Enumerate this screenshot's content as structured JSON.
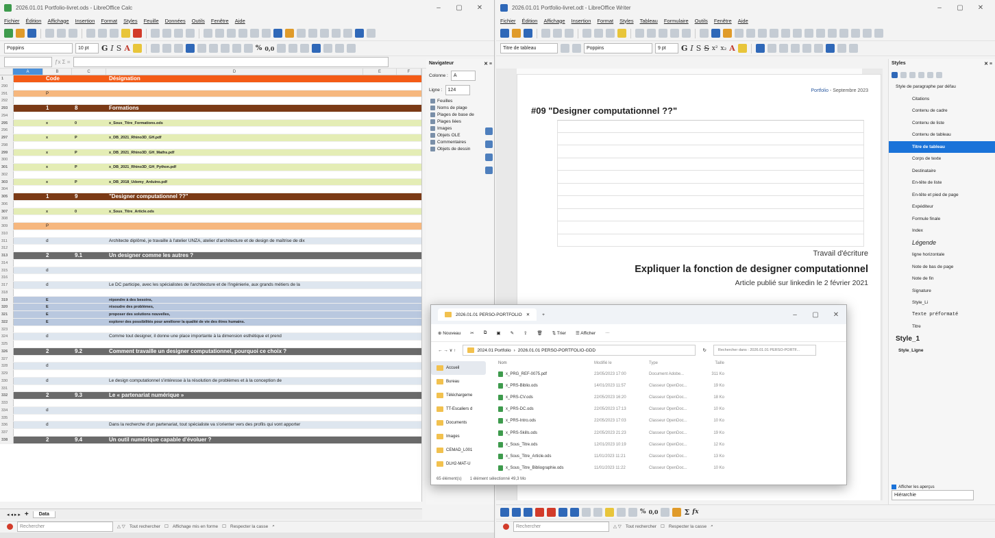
{
  "calc": {
    "title": "2026.01.01 Portfolio-livret.ods - LibreOffice Calc",
    "menu": [
      "Fichier",
      "Édition",
      "Affichage",
      "Insertion",
      "Format",
      "Styles",
      "Feuille",
      "Données",
      "Outils",
      "Fenêtre",
      "Aide"
    ],
    "font_name": "Poppins",
    "font_size": "10 pt",
    "columns": [
      "A",
      "B",
      "C",
      "D",
      "E",
      "F"
    ],
    "rows": [
      {
        "n": "1",
        "style": "hdr",
        "b": "Code",
        "c": "",
        "d": "Désignation"
      },
      {
        "n": "290",
        "style": "",
        "b": "",
        "c": "",
        "d": ""
      },
      {
        "n": "291",
        "style": "orange",
        "b": "P",
        "c": "",
        "d": ""
      },
      {
        "n": "292",
        "style": "",
        "b": "",
        "c": "",
        "d": ""
      },
      {
        "n": "293",
        "style": "sec",
        "b": "1",
        "c": "8",
        "d": "Formations"
      },
      {
        "n": "294",
        "style": "",
        "b": "",
        "c": "",
        "d": ""
      },
      {
        "n": "295",
        "style": "lime",
        "b": "x",
        "c": "0",
        "d": "x_Sous_Titre_Formations.ods"
      },
      {
        "n": "296",
        "style": "",
        "b": "",
        "c": "",
        "d": ""
      },
      {
        "n": "297",
        "style": "lime",
        "b": "x",
        "c": "P",
        "d": "x_DB_2021_Rhino3D_GH.pdf"
      },
      {
        "n": "298",
        "style": "",
        "b": "",
        "c": "",
        "d": ""
      },
      {
        "n": "299",
        "style": "lime",
        "b": "x",
        "c": "P",
        "d": "x_DB_2021_Rhino3D_GH_Maths.pdf"
      },
      {
        "n": "300",
        "style": "",
        "b": "",
        "c": "",
        "d": ""
      },
      {
        "n": "301",
        "style": "lime",
        "b": "x",
        "c": "P",
        "d": "x_DB_2021_Rhino3D_GH_Python.pdf"
      },
      {
        "n": "302",
        "style": "",
        "b": "",
        "c": "",
        "d": ""
      },
      {
        "n": "303",
        "style": "lime",
        "b": "x",
        "c": "P",
        "d": "x_DB_2018_Udemy_Arduino.pdf"
      },
      {
        "n": "304",
        "style": "",
        "b": "",
        "c": "",
        "d": ""
      },
      {
        "n": "305",
        "style": "sec",
        "b": "1",
        "c": "9",
        "d": "\"Designer computationnel ??\""
      },
      {
        "n": "306",
        "style": "",
        "b": "",
        "c": "",
        "d": ""
      },
      {
        "n": "307",
        "style": "lime",
        "b": "x",
        "c": "0",
        "d": "x_Sous_Titre_Article.ods"
      },
      {
        "n": "308",
        "style": "",
        "b": "",
        "c": "",
        "d": ""
      },
      {
        "n": "309",
        "style": "orange",
        "b": "P",
        "c": "",
        "d": ""
      },
      {
        "n": "310",
        "style": "",
        "b": "",
        "c": "",
        "d": ""
      },
      {
        "n": "311",
        "style": "lblue",
        "b": "d",
        "c": "",
        "d": "Architecte diplômé, je travaille à l'atelier UNZA, atelier d'architecture et de design de maîtrise de dix"
      },
      {
        "n": "312",
        "style": "",
        "b": "",
        "c": "",
        "d": ""
      },
      {
        "n": "313",
        "style": "grey",
        "b": "2",
        "c": "9.1",
        "d": "Un designer comme les autres ?"
      },
      {
        "n": "314",
        "style": "",
        "b": "",
        "c": "",
        "d": ""
      },
      {
        "n": "315",
        "style": "lblue",
        "b": "d",
        "c": "",
        "d": ""
      },
      {
        "n": "316",
        "style": "",
        "b": "",
        "c": "",
        "d": ""
      },
      {
        "n": "317",
        "style": "lblue",
        "b": "d",
        "c": "",
        "d": "Le DC participe, avec les spécialistes de l'architecture et de l'ingénierie, aux grands métiers de la"
      },
      {
        "n": "318",
        "style": "",
        "b": "",
        "c": "",
        "d": ""
      },
      {
        "n": "319",
        "style": "blue",
        "b": "E",
        "c": "",
        "d": "répondre à des besoins,"
      },
      {
        "n": "320",
        "style": "blue",
        "b": "E",
        "c": "",
        "d": "résoudre des problèmes,"
      },
      {
        "n": "321",
        "style": "blue",
        "b": "E",
        "c": "",
        "d": "proposer des solutions nouvelles,"
      },
      {
        "n": "322",
        "style": "blue",
        "b": "E",
        "c": "",
        "d": "explorer des possibilités pour améliorer la qualité de vie des êtres humains."
      },
      {
        "n": "323",
        "style": "",
        "b": "",
        "c": "",
        "d": ""
      },
      {
        "n": "324",
        "style": "lblue",
        "b": "d",
        "c": "",
        "d": "Comme tout designer, il donne une place importante à la dimension esthétique et prend"
      },
      {
        "n": "325",
        "style": "",
        "b": "",
        "c": "",
        "d": ""
      },
      {
        "n": "326",
        "style": "grey",
        "b": "2",
        "c": "9.2",
        "d": "Comment travaille un designer computationnel, pourquoi ce choix ?"
      },
      {
        "n": "327",
        "style": "",
        "b": "",
        "c": "",
        "d": ""
      },
      {
        "n": "328",
        "style": "lblue",
        "b": "d",
        "c": "",
        "d": ""
      },
      {
        "n": "329",
        "style": "",
        "b": "",
        "c": "",
        "d": ""
      },
      {
        "n": "330",
        "style": "lblue",
        "b": "d",
        "c": "",
        "d": "Le design computationnel s'intéresse à la résolution de problèmes et à la conception de"
      },
      {
        "n": "331",
        "style": "",
        "b": "",
        "c": "",
        "d": ""
      },
      {
        "n": "332",
        "style": "grey",
        "b": "2",
        "c": "9.3",
        "d": "Le « partenariat numérique »"
      },
      {
        "n": "333",
        "style": "",
        "b": "",
        "c": "",
        "d": ""
      },
      {
        "n": "334",
        "style": "lblue",
        "b": "d",
        "c": "",
        "d": ""
      },
      {
        "n": "335",
        "style": "",
        "b": "",
        "c": "",
        "d": ""
      },
      {
        "n": "336",
        "style": "lblue",
        "b": "d",
        "c": "",
        "d": "Dans la recherche d'un partenariat, tout spécialiste va s'orienter vers des profils qui vont apporter"
      },
      {
        "n": "337",
        "style": "",
        "b": "",
        "c": "",
        "d": ""
      },
      {
        "n": "338",
        "style": "grey",
        "b": "2",
        "c": "9.4",
        "d": "Un outil numérique capable d'évoluer ?"
      }
    ],
    "sheet_tab": "Data",
    "find_placeholder": "Rechercher",
    "find_all": "Tout rechercher",
    "find_formatted": "Affichage mis en forme",
    "find_case": "Respecter la casse",
    "navigator": {
      "title": "Navigateur",
      "col_label": "Colonne :",
      "col_value": "A",
      "row_label": "Ligne :",
      "row_value": "124",
      "items": [
        "Feuilles",
        "Noms de plage",
        "Plages de base de",
        "Plages liées",
        "Images",
        "Objets OLE",
        "Commentaires",
        "Objets de dessin"
      ]
    }
  },
  "writer": {
    "title": "2026.01.01 Portfolio-livret.odt - LibreOffice Writer",
    "menu": [
      "Fichier",
      "Édition",
      "Affichage",
      "Insertion",
      "Format",
      "Styles",
      "Tableau",
      "Formulaire",
      "Outils",
      "Fenêtre",
      "Aide"
    ],
    "para_style": "Titre de tableau",
    "font_name": "Poppins",
    "font_size": "9 pt",
    "header_portfolio": "Portfolio",
    "header_date": "- Septembre 2023",
    "doc_title": "#09 \"Designer computationnel ??\"",
    "travail": "Travail d'écriture",
    "expliquer": "Expliquer la fonction de designer computationnel",
    "article": "Article publié sur linkedin le 2 février 2021",
    "find_placeholder": "Rechercher",
    "find_all": "Tout rechercher",
    "find_case": "Respecter la casse",
    "styles": {
      "title": "Styles",
      "items": [
        {
          "label": "Style de paragraphe par défau",
          "kind": "root"
        },
        {
          "label": "Citations",
          "kind": "ind"
        },
        {
          "label": "Contenu de cadre",
          "kind": "ind"
        },
        {
          "label": "Contenu de liste",
          "kind": "ind"
        },
        {
          "label": "Contenu de tableau",
          "kind": "ind"
        },
        {
          "label": "Titre de tableau",
          "kind": "sel"
        },
        {
          "label": "Corps de texte",
          "kind": "ind"
        },
        {
          "label": "Destinataire",
          "kind": "ind"
        },
        {
          "label": "En-tête de liste",
          "kind": "ind"
        },
        {
          "label": "En-tête et pied de page",
          "kind": "ind"
        },
        {
          "label": "Expéditeur",
          "kind": "ind"
        },
        {
          "label": "Formule finale",
          "kind": "ind"
        },
        {
          "label": "Index",
          "kind": "ind"
        },
        {
          "label": "Légende",
          "kind": "ital"
        },
        {
          "label": "ligne horizontale",
          "kind": "ind"
        },
        {
          "label": "Note de bas de page",
          "kind": "ind"
        },
        {
          "label": "Note de fin",
          "kind": "ind"
        },
        {
          "label": "Signature",
          "kind": "ind"
        },
        {
          "label": "Style_Li",
          "kind": "ind"
        },
        {
          "label": "Texte préformaté",
          "kind": "mono"
        },
        {
          "label": "Titre",
          "kind": "ind"
        },
        {
          "label": "Style_1",
          "kind": "big"
        },
        {
          "label": "Style_Ligne",
          "kind": "bold"
        }
      ],
      "show_previews": "Afficher les aperçus",
      "filter": "Hiérarchie"
    }
  },
  "explorer": {
    "tab_title": "2026.01.01 PERSO-PORTFOLIO",
    "cmd_new": "Nouveau",
    "cmd_sort": "Trier",
    "cmd_view": "Afficher",
    "breadcrumb": [
      "2024.01 Portfolio",
      "2026.01.01 PERSO-PORTFOLIO-GDD"
    ],
    "search_placeholder": "Rechercher dans : 2026.01.01 PERSO-PORTF...",
    "nav": [
      "Accueil",
      "Bureau",
      "Téléchargeme",
      "TT-Escaliers d",
      "Documents",
      "Images",
      "CEMAD_L001",
      "DLH2-MAT-U"
    ],
    "headers": [
      "Nom",
      "Modifié le",
      "Type",
      "Taille"
    ],
    "files": [
      {
        "name": "x_PRG_REF-0075.pdf",
        "date": "23/05/2023 17:00",
        "type": "Document Adobe...",
        "size": "311 Ko"
      },
      {
        "name": "x_PRS-Biblio.ods",
        "date": "14/01/2023 11:57",
        "type": "Classeur OpenDoc...",
        "size": "19 Ko"
      },
      {
        "name": "x_PRS-CV.ods",
        "date": "22/05/2023 16:20",
        "type": "Classeur OpenDoc...",
        "size": "18 Ko"
      },
      {
        "name": "x_PRS-DC.ods",
        "date": "22/05/2023 17:13",
        "type": "Classeur OpenDoc...",
        "size": "10 Ko"
      },
      {
        "name": "x_PRS-Intro.ods",
        "date": "22/05/2023 17:03",
        "type": "Classeur OpenDoc...",
        "size": "10 Ko"
      },
      {
        "name": "x_PRS-Skills.ods",
        "date": "22/05/2023 21:23",
        "type": "Classeur OpenDoc...",
        "size": "19 Ko"
      },
      {
        "name": "x_Sous_Titre.ods",
        "date": "12/01/2023 10:19",
        "type": "Classeur OpenDoc...",
        "size": "12 Ko"
      },
      {
        "name": "x_Sous_Titre_Article.ods",
        "date": "11/01/2023 11:21",
        "type": "Classeur OpenDoc...",
        "size": "13 Ko"
      },
      {
        "name": "x_Sous_Titre_Bibliographie.ods",
        "date": "11/01/2023 11:22",
        "type": "Classeur OpenDoc...",
        "size": "10 Ko"
      }
    ],
    "status_count": "65 élément(s)",
    "status_selected": "1 élément sélectionné  49,3 Mo"
  }
}
